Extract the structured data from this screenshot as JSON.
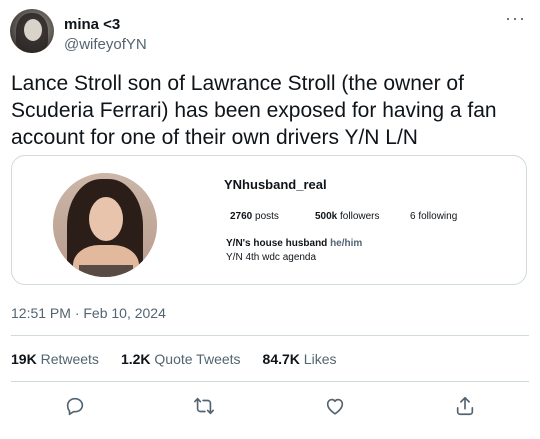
{
  "tweet": {
    "author": {
      "display_name": "mina <3",
      "handle": "@wifeyofYN"
    },
    "text": "Lance Stroll son of Lawrance Stroll (the owner of Scuderia Ferrari) has been exposed for having a fan account for one of their own drivers Y/N L/N",
    "timestamp": "12:51 PM · Feb 10, 2024",
    "stats": {
      "retweets_count": "19K",
      "retweets_label": "Retweets",
      "quotes_count": "1.2K",
      "quotes_label": "Quote Tweets",
      "likes_count": "84.7K",
      "likes_label": "Likes"
    }
  },
  "embedded_profile": {
    "username": "YNhusband_real",
    "posts_count": "2760",
    "posts_label": "posts",
    "followers_count": "500k",
    "followers_label": "followers",
    "following_count": "6",
    "following_label": "following",
    "bio_name": "Y/N's house husband",
    "bio_pronouns": "he/him",
    "bio_line": "Y/N 4th wdc agenda"
  },
  "icons": {
    "more": "more-icon",
    "reply": "reply-icon",
    "retweet": "retweet-icon",
    "like": "heart-icon",
    "share": "share-icon"
  },
  "colors": {
    "text": "#0f1419",
    "secondary": "#536471",
    "border": "#cfd9de"
  }
}
